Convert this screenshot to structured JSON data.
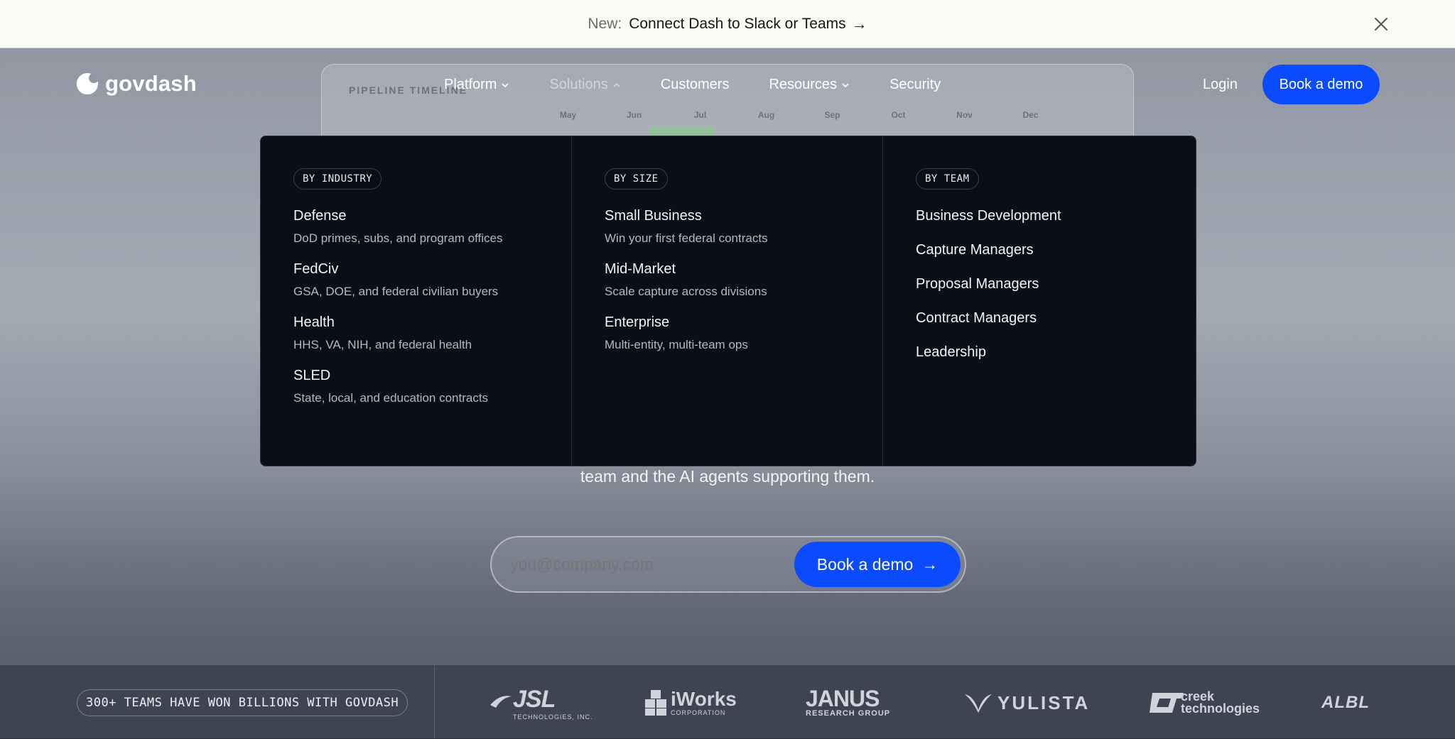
{
  "announcement": {
    "prefix": "New:",
    "message": "Connect Dash to Slack or Teams",
    "arrow": "→"
  },
  "background_preview": {
    "title": "PIPELINE TIMELINE",
    "months": [
      "May",
      "Jun",
      "Jul",
      "Aug",
      "Sep",
      "Oct",
      "Nov",
      "Dec"
    ]
  },
  "nav": {
    "logo_text": "govdash",
    "items": [
      {
        "label": "Platform",
        "has_caret": true,
        "state": "normal"
      },
      {
        "label": "Solutions",
        "has_caret": true,
        "state": "open"
      },
      {
        "label": "Customers",
        "has_caret": false,
        "state": "normal"
      },
      {
        "label": "Resources",
        "has_caret": true,
        "state": "normal"
      },
      {
        "label": "Security",
        "has_caret": false,
        "state": "normal"
      }
    ],
    "login_label": "Login",
    "demo_label": "Book a demo"
  },
  "solutions_menu": {
    "industry": {
      "heading": "BY INDUSTRY",
      "items": [
        {
          "title": "Defense",
          "desc": "DoD primes, subs, and program offices"
        },
        {
          "title": "FedCiv",
          "desc": "GSA, DOE, and federal civilian buyers"
        },
        {
          "title": "Health",
          "desc": "HHS, VA, NIH, and federal health"
        },
        {
          "title": "SLED",
          "desc": "State, local, and education contracts"
        }
      ]
    },
    "size": {
      "heading": "BY SIZE",
      "items": [
        {
          "title": "Small Business",
          "desc": "Win your first federal contracts"
        },
        {
          "title": "Mid-Market",
          "desc": "Scale capture across divisions"
        },
        {
          "title": "Enterprise",
          "desc": "Multi-entity, multi-team ops"
        }
      ]
    },
    "team": {
      "heading": "BY TEAM",
      "items": [
        "Business Development",
        "Capture Managers",
        "Proposal Managers",
        "Contract Managers",
        "Leadership"
      ]
    }
  },
  "hero": {
    "subtitle_tail": "team and the AI agents supporting them.",
    "email_placeholder": "you@company.com",
    "cta_label": "Book a demo",
    "cta_arrow": "→"
  },
  "customers_strip": {
    "badge": "300+ TEAMS HAVE WON BILLIONS WITH GOVDASH",
    "logos": [
      {
        "name": "JSL",
        "sub": "TECHNOLOGIES, INC."
      },
      {
        "name": "iWorks",
        "sub": "CORPORATION"
      },
      {
        "name": "JANUS",
        "sub": "RESEARCH GROUP"
      },
      {
        "name": "YULISTA",
        "sub": ""
      },
      {
        "name": "creek technologies",
        "sub": ""
      },
      {
        "name": "ALBL",
        "sub": ""
      }
    ]
  },
  "colors": {
    "accent": "#0a4bff",
    "menu_bg": "#0a0e17",
    "announce_bg": "#fbfaf7"
  }
}
